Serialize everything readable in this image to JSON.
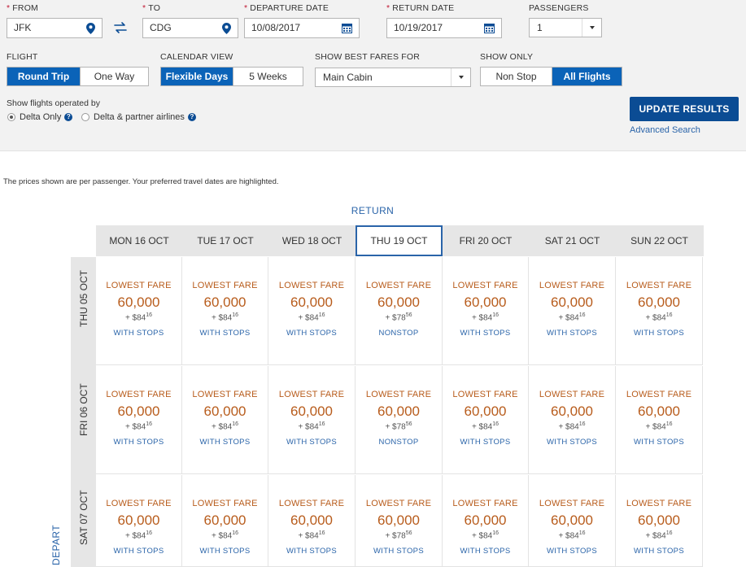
{
  "search": {
    "from_label": "FROM",
    "from_value": "JFK",
    "to_label": "TO",
    "to_value": "CDG",
    "departure_label": "DEPARTURE DATE",
    "departure_value": "10/08/2017",
    "return_label": "RETURN DATE",
    "return_value": "10/19/2017",
    "passengers_label": "PASSENGERS",
    "passengers_value": "1"
  },
  "options": {
    "flight_label": "FLIGHT",
    "flight_round_trip": "Round Trip",
    "flight_one_way": "One Way",
    "calendar_label": "CALENDAR VIEW",
    "calendar_flexible": "Flexible Days",
    "calendar_weeks": "5 Weeks",
    "fares_label": "SHOW BEST FARES FOR",
    "fares_value": "Main Cabin",
    "show_only_label": "SHOW ONLY",
    "show_nonstop": "Non Stop",
    "show_all": "All Flights",
    "operated_label": "Show flights operated by",
    "operated_delta": "Delta Only",
    "operated_partner": "Delta & partner airlines",
    "help_glyph": "?",
    "update_button": "UPDATE RESULTS",
    "advanced_link": "Advanced Search"
  },
  "note": "The prices shown are per passenger. Your preferred travel dates are highlighted.",
  "grid": {
    "return_title": "RETURN",
    "depart_title": "DEPART",
    "columns": [
      "MON 16 OCT",
      "TUE 17 OCT",
      "WED 18 OCT",
      "THU 19 OCT",
      "FRI 20 OCT",
      "SAT 21 OCT",
      "SUN 22 OCT"
    ],
    "highlight_column": 3,
    "rows": [
      {
        "label": "THU 05 OCT",
        "cells": [
          {
            "label": "LOWEST FARE",
            "miles": "60,000",
            "tax_prefix": "+ $",
            "tax_dollars": "84",
            "tax_cents": "16",
            "stops": "WITH STOPS"
          },
          {
            "label": "LOWEST FARE",
            "miles": "60,000",
            "tax_prefix": "+ $",
            "tax_dollars": "84",
            "tax_cents": "16",
            "stops": "WITH STOPS"
          },
          {
            "label": "LOWEST FARE",
            "miles": "60,000",
            "tax_prefix": "+ $",
            "tax_dollars": "84",
            "tax_cents": "16",
            "stops": "WITH STOPS"
          },
          {
            "label": "LOWEST FARE",
            "miles": "60,000",
            "tax_prefix": "+ $",
            "tax_dollars": "78",
            "tax_cents": "56",
            "stops": "NONSTOP"
          },
          {
            "label": "LOWEST FARE",
            "miles": "60,000",
            "tax_prefix": "+ $",
            "tax_dollars": "84",
            "tax_cents": "16",
            "stops": "WITH STOPS"
          },
          {
            "label": "LOWEST FARE",
            "miles": "60,000",
            "tax_prefix": "+ $",
            "tax_dollars": "84",
            "tax_cents": "16",
            "stops": "WITH STOPS"
          },
          {
            "label": "LOWEST FARE",
            "miles": "60,000",
            "tax_prefix": "+ $",
            "tax_dollars": "84",
            "tax_cents": "16",
            "stops": "WITH STOPS"
          }
        ]
      },
      {
        "label": "FRI 06 OCT",
        "cells": [
          {
            "label": "LOWEST FARE",
            "miles": "60,000",
            "tax_prefix": "+ $",
            "tax_dollars": "84",
            "tax_cents": "16",
            "stops": "WITH STOPS"
          },
          {
            "label": "LOWEST FARE",
            "miles": "60,000",
            "tax_prefix": "+ $",
            "tax_dollars": "84",
            "tax_cents": "16",
            "stops": "WITH STOPS"
          },
          {
            "label": "LOWEST FARE",
            "miles": "60,000",
            "tax_prefix": "+ $",
            "tax_dollars": "84",
            "tax_cents": "16",
            "stops": "WITH STOPS"
          },
          {
            "label": "LOWEST FARE",
            "miles": "60,000",
            "tax_prefix": "+ $",
            "tax_dollars": "78",
            "tax_cents": "56",
            "stops": "NONSTOP"
          },
          {
            "label": "LOWEST FARE",
            "miles": "60,000",
            "tax_prefix": "+ $",
            "tax_dollars": "84",
            "tax_cents": "16",
            "stops": "WITH STOPS"
          },
          {
            "label": "LOWEST FARE",
            "miles": "60,000",
            "tax_prefix": "+ $",
            "tax_dollars": "84",
            "tax_cents": "16",
            "stops": "WITH STOPS"
          },
          {
            "label": "LOWEST FARE",
            "miles": "60,000",
            "tax_prefix": "+ $",
            "tax_dollars": "84",
            "tax_cents": "16",
            "stops": "WITH STOPS"
          }
        ]
      },
      {
        "label": "SAT 07 OCT",
        "cells": [
          {
            "label": "LOWEST FARE",
            "miles": "60,000",
            "tax_prefix": "+ $",
            "tax_dollars": "84",
            "tax_cents": "16",
            "stops": "WITH STOPS"
          },
          {
            "label": "LOWEST FARE",
            "miles": "60,000",
            "tax_prefix": "+ $",
            "tax_dollars": "84",
            "tax_cents": "16",
            "stops": "WITH STOPS"
          },
          {
            "label": "LOWEST FARE",
            "miles": "60,000",
            "tax_prefix": "+ $",
            "tax_dollars": "84",
            "tax_cents": "16",
            "stops": "WITH STOPS"
          },
          {
            "label": "LOWEST FARE",
            "miles": "60,000",
            "tax_prefix": "+ $",
            "tax_dollars": "78",
            "tax_cents": "56",
            "stops": "WITH STOPS"
          },
          {
            "label": "LOWEST FARE",
            "miles": "60,000",
            "tax_prefix": "+ $",
            "tax_dollars": "84",
            "tax_cents": "16",
            "stops": "WITH STOPS"
          },
          {
            "label": "LOWEST FARE",
            "miles": "60,000",
            "tax_prefix": "+ $",
            "tax_dollars": "84",
            "tax_cents": "16",
            "stops": "WITH STOPS"
          },
          {
            "label": "LOWEST FARE",
            "miles": "60,000",
            "tax_prefix": "+ $",
            "tax_dollars": "84",
            "tax_cents": "16",
            "stops": "WITH STOPS"
          }
        ]
      }
    ]
  },
  "icons": {
    "location": "map-pin-icon",
    "swap": "swap-arrows-icon",
    "calendar": "calendar-icon",
    "dropdown": "chevron-down-icon",
    "help": "help-icon"
  },
  "colors": {
    "brand_blue": "#0b4c94",
    "selected_blue": "#0b63b8",
    "link_blue": "#2a64a9",
    "fare_orange": "#b85c1c",
    "required_red": "#c01933"
  }
}
